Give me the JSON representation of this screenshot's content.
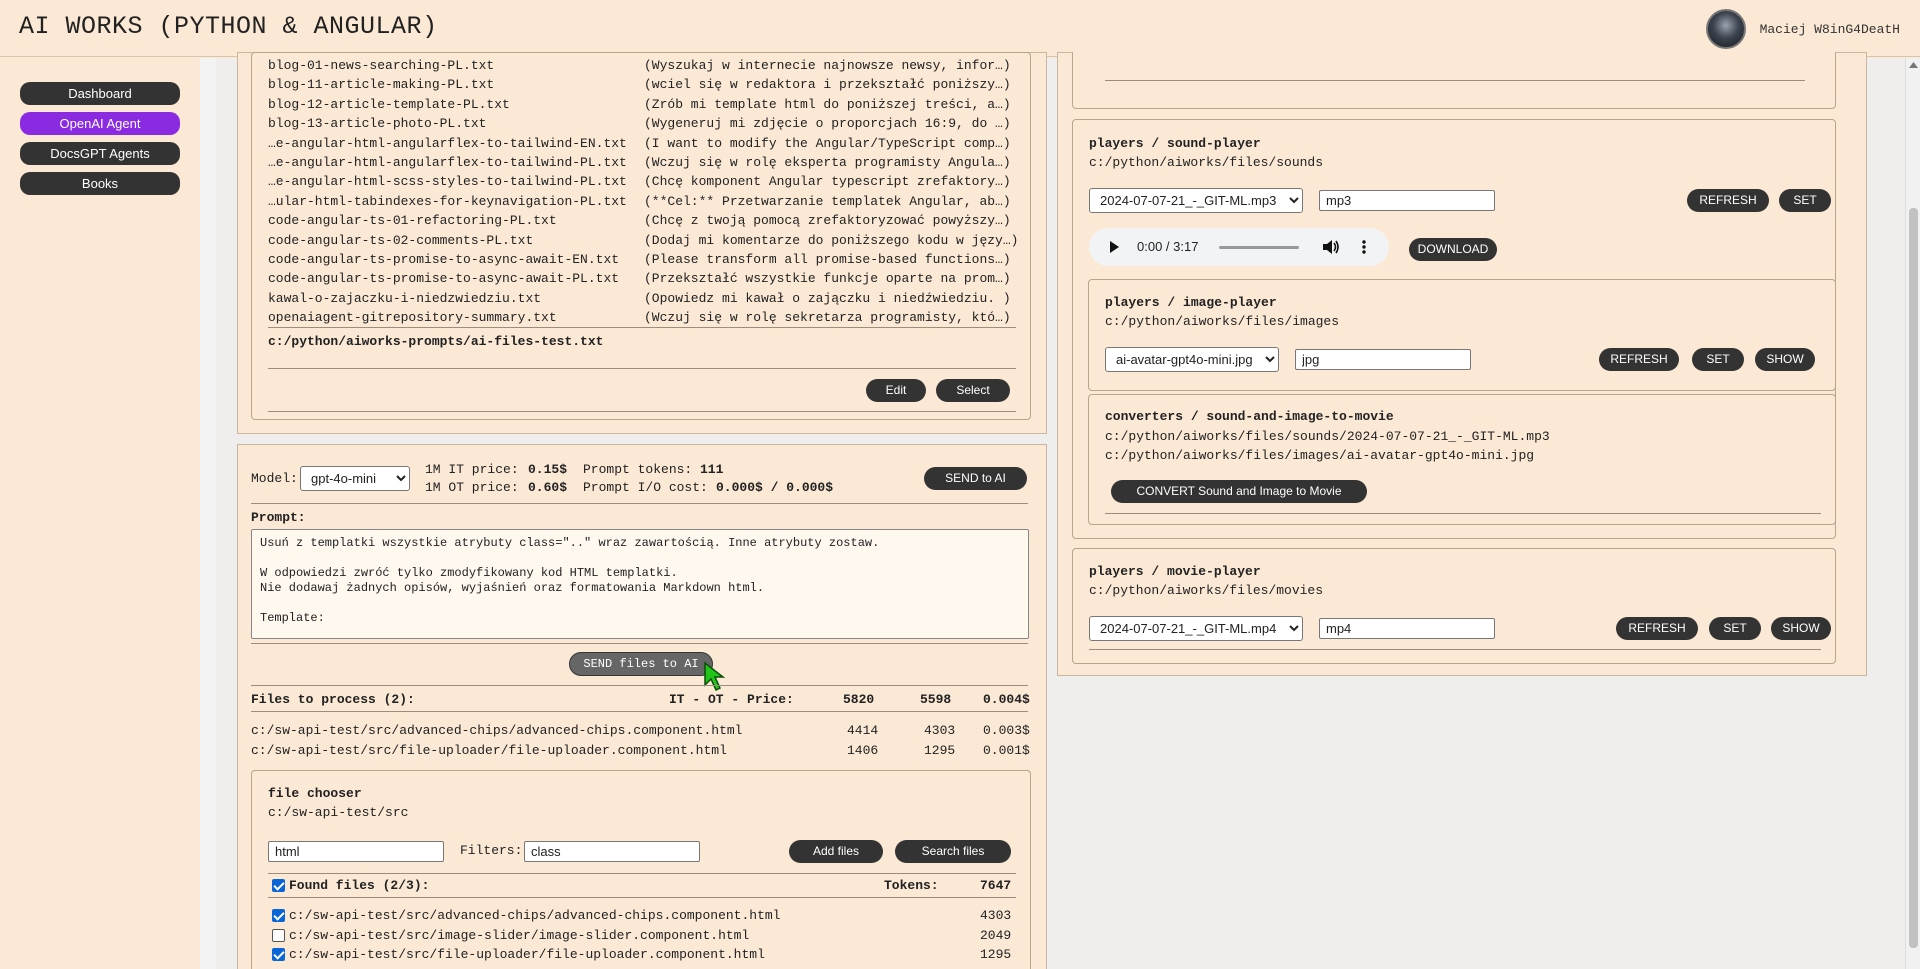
{
  "header": {
    "title": "AI WORKS (PYTHON & ANGULAR)",
    "user_name": "Maciej W8inG4DeatH"
  },
  "sidebar": {
    "items": [
      {
        "label": "Dashboard",
        "active": false
      },
      {
        "label": "OpenAI Agent",
        "active": true
      },
      {
        "label": "DocsGPT Agents",
        "active": false
      },
      {
        "label": "Books",
        "active": false
      }
    ]
  },
  "prompt_files": {
    "rows": [
      {
        "name": "blog-01-news-searching-PL.txt",
        "desc": "(Wyszukaj w internecie najnowsze newsy, infor…)"
      },
      {
        "name": "blog-11-article-making-PL.txt",
        "desc": "(wciel się w redaktora i przekształć poniższy…)"
      },
      {
        "name": "blog-12-article-template-PL.txt",
        "desc": "(Zrób mi template html do poniższej treści, a…)"
      },
      {
        "name": "blog-13-article-photo-PL.txt",
        "desc": "(Wygeneruj mi zdjęcie o proporcjach 16:9, do …)"
      },
      {
        "name": "…e-angular-html-angularflex-to-tailwind-EN.txt",
        "desc": "(I want to modify the Angular/TypeScript comp…)"
      },
      {
        "name": "…e-angular-html-angularflex-to-tailwind-PL.txt",
        "desc": "(Wczuj się w rolę eksperta programisty Angula…)"
      },
      {
        "name": "…e-angular-html-scss-styles-to-tailwind-PL.txt",
        "desc": "(Chcę komponent Angular typescript zrefaktory…)"
      },
      {
        "name": "…ular-html-tabindexes-for-keynavigation-PL.txt",
        "desc": "(**Cel:** Przetwarzanie templatek Angular, ab…)"
      },
      {
        "name": "code-angular-ts-01-refactoring-PL.txt",
        "desc": "(Chcę z twoją pomocą zrefaktoryzować powyższy…)"
      },
      {
        "name": "code-angular-ts-02-comments-PL.txt",
        "desc": "(Dodaj mi komentarze do poniższego kodu w języ…)"
      },
      {
        "name": "code-angular-ts-promise-to-async-await-EN.txt",
        "desc": "(Please transform all promise-based functions…)"
      },
      {
        "name": "code-angular-ts-promise-to-async-await-PL.txt",
        "desc": "(Przekształć wszystkie funkcje oparte na prom…)"
      },
      {
        "name": "kawal-o-zajaczku-i-niedzwiedziu.txt",
        "desc": "(Opowiedz mi kawał o zajączku i niedźwiedziu. )"
      },
      {
        "name": "openaiagent-gitrepository-summary.txt",
        "desc": "(Wczuj się w rolę sekretarza programisty, któ…)"
      }
    ],
    "selected_path": "c:/python/aiworks-prompts/ai-files-test.txt",
    "edit_label": "Edit",
    "select_label": "Select"
  },
  "model_bar": {
    "model_label": "Model:",
    "model_value": "gpt-4o-mini",
    "it_price_label": "1M IT price:",
    "it_price_value": "0.15$",
    "ot_price_label": "1M OT price:",
    "ot_price_value": "0.60$",
    "prompt_tokens_label": "Prompt tokens:",
    "prompt_tokens_value": "111",
    "prompt_cost_label": "Prompt I/O cost:",
    "prompt_cost_value": "0.000$ / 0.000$",
    "send_label": "SEND to AI"
  },
  "prompt": {
    "label": "Prompt:",
    "lines": [
      "Usuń z templatki wszystkie atrybuty class=\"..\" wraz zawartością. Inne atrybuty zostaw.",
      "",
      "W odpowiedzi zwróć tylko zmodyfikowany kod HTML templatki.",
      "Nie dodawaj żadnych opisów, wyjaśnień oraz formatowania Markdown html.",
      "",
      "Template:"
    ],
    "send_files_label": "SEND files to AI"
  },
  "files_to_process": {
    "title": "Files to process (2):",
    "header_label": "IT - OT - Price:",
    "total_it": "5820",
    "total_ot": "5598",
    "total_price": "0.004$",
    "rows": [
      {
        "path": "c:/sw-api-test/src/advanced-chips/advanced-chips.component.html",
        "it": "4414",
        "ot": "4303",
        "price": "0.003$"
      },
      {
        "path": "c:/sw-api-test/src/file-uploader/file-uploader.component.html",
        "it": "1406",
        "ot": "1295",
        "price": "0.001$"
      }
    ]
  },
  "file_chooser": {
    "title": "file chooser",
    "path": "c:/sw-api-test/src",
    "ext_value": "html",
    "filters_label": "Filters:",
    "filters_value": "class",
    "add_label": "Add files",
    "search_label": "Search files",
    "found_title": "Found files (2/3):",
    "tokens_label": "Tokens:",
    "tokens_value": "7647",
    "rows": [
      {
        "path": "c:/sw-api-test/src/advanced-chips/advanced-chips.component.html",
        "tokens": "4303",
        "checked": true
      },
      {
        "path": "c:/sw-api-test/src/image-slider/image-slider.component.html",
        "tokens": "2049",
        "checked": false
      },
      {
        "path": "c:/sw-api-test/src/file-uploader/file-uploader.component.html",
        "tokens": "1295",
        "checked": true
      }
    ]
  },
  "sound_player": {
    "title": "players / sound-player",
    "path": "c:/python/aiworks/files/sounds",
    "file_value": "2024-07-07-21_-_GIT-ML.mp3",
    "ext_value": "mp3",
    "refresh_label": "REFRESH",
    "set_label": "SET",
    "time": "0:00 / 3:17",
    "download_label": "DOWNLOAD"
  },
  "image_player": {
    "title": "players / image-player",
    "path": "c:/python/aiworks/files/images",
    "file_value": "ai-avatar-gpt4o-mini.jpg",
    "ext_value": "jpg",
    "refresh_label": "REFRESH",
    "set_label": "SET",
    "show_label": "SHOW"
  },
  "converter": {
    "title": "converters / sound-and-image-to-movie",
    "sound_path": "c:/python/aiworks/files/sounds/2024-07-07-21_-_GIT-ML.mp3",
    "image_path": "c:/python/aiworks/files/images/ai-avatar-gpt4o-mini.jpg",
    "convert_label": "CONVERT Sound and Image to Movie"
  },
  "movie_player": {
    "title": "players / movie-player",
    "path": "c:/python/aiworks/files/movies",
    "file_value": "2024-07-07-21_-_GIT-ML.mp4",
    "ext_value": "mp4",
    "refresh_label": "REFRESH",
    "set_label": "SET",
    "show_label": "SHOW"
  },
  "colors": {
    "background": "#fbe9d5",
    "button": "#333333",
    "active_nav": "#8a2be2",
    "cursor": "#22c41c"
  }
}
